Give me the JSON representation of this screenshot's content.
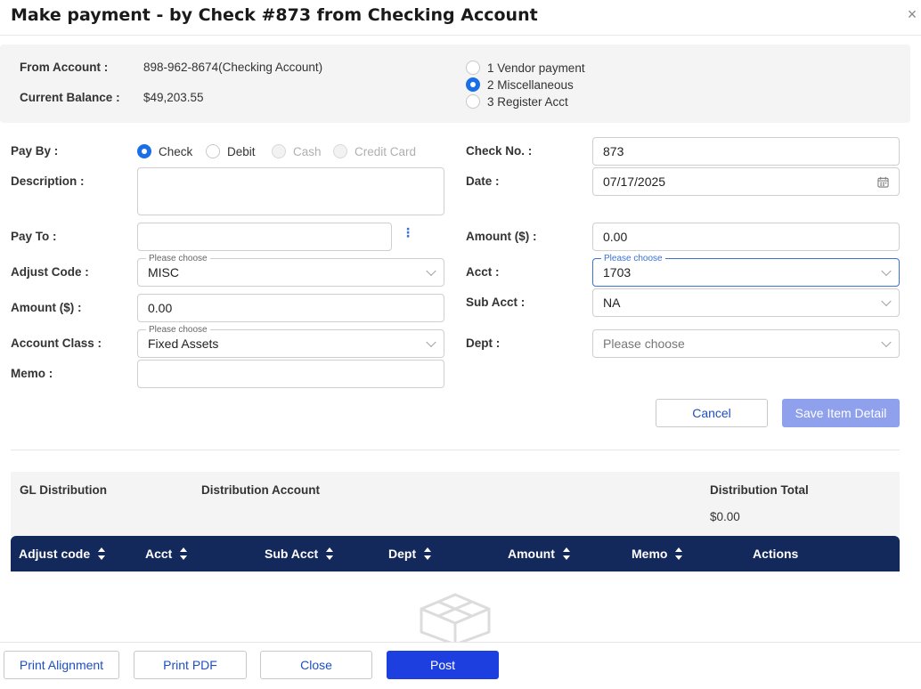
{
  "dialog": {
    "title": "Make payment - by Check #873 from Checking Account",
    "close_icon": "×"
  },
  "info": {
    "from_account_label": "From Account",
    "from_account_value": "898-962-8674(Checking Account)",
    "balance_label": "Current Balance",
    "balance_value": "$49,203.55",
    "payment_types": [
      {
        "label": "1 Vendor payment",
        "selected": false
      },
      {
        "label": "2 Miscellaneous",
        "selected": true
      },
      {
        "label": "3 Register Acct",
        "selected": false
      }
    ]
  },
  "form": {
    "pay_by_label": "Pay By",
    "pay_by_options": [
      {
        "label": "Check",
        "selected": true,
        "disabled": false
      },
      {
        "label": "Debit",
        "selected": false,
        "disabled": false
      },
      {
        "label": "Cash",
        "selected": false,
        "disabled": true
      },
      {
        "label": "Credit Card",
        "selected": false,
        "disabled": true
      }
    ],
    "description_label": "Description",
    "description_value": "",
    "pay_to_label": "Pay To",
    "pay_to_value": "",
    "more_icon": "⋮",
    "adjust_code_label": "Adjust Code",
    "adjust_code_float": "Please choose",
    "adjust_code_value": "MISC",
    "amount_left_label": "Amount ($)",
    "amount_left_value": "0.00",
    "account_class_label": "Account Class",
    "account_class_float": "Please choose",
    "account_class_value": "Fixed Assets",
    "memo_label": "Memo",
    "memo_value": "",
    "check_no_label": "Check No. ",
    "check_no_value": "873",
    "date_label": "Date",
    "date_value": "07/17/2025",
    "amount_right_label": "Amount ($)",
    "amount_right_value": "0.00",
    "acct_label": "Acct",
    "acct_float": "Please choose",
    "acct_value": "1703",
    "sub_acct_label": "Sub Acct",
    "sub_acct_value": "NA",
    "dept_label": "Dept",
    "dept_placeholder": "Please choose",
    "colon": ":",
    "cancel_label": "Cancel",
    "save_label": "Save Item Detail"
  },
  "gl": {
    "gl_label": "GL Distribution",
    "dist_account_label": "Distribution Account",
    "dist_total_label": "Distribution Total",
    "dist_total_value": "$0.00"
  },
  "table": {
    "columns": [
      "Adjust code",
      "Acct",
      "Sub Acct",
      "Dept",
      "Amount",
      "Memo",
      "Actions"
    ],
    "empty_icon": "empty-box-icon"
  },
  "footer": {
    "print_alignment": "Print Alignment",
    "print_pdf": "Print PDF",
    "close": "Close",
    "post": "Post"
  },
  "colors": {
    "table_header": "#13285b",
    "primary": "#1e3fe0",
    "primary_disabled": "#8fa0ec",
    "radio_selected": "#1a6fe6"
  }
}
